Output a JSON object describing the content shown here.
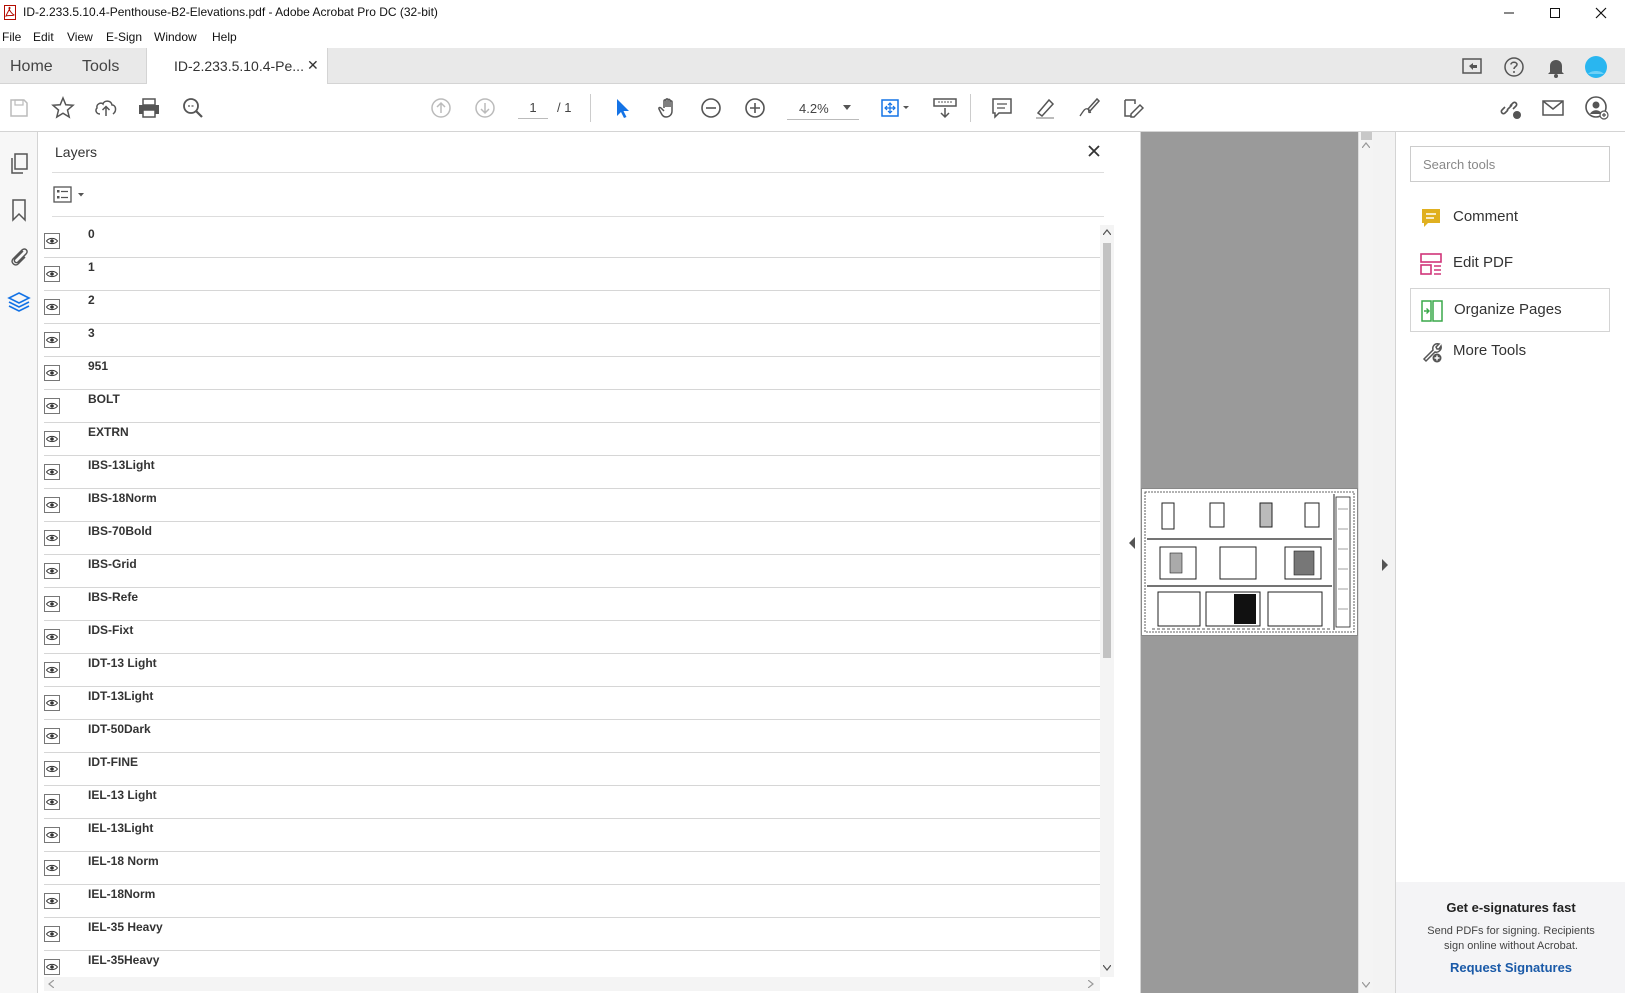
{
  "window": {
    "title": "ID-2.233.5.10.4-Penthouse-B2-Elevations.pdf - Adobe Acrobat Pro DC (32-bit)"
  },
  "menu": [
    "File",
    "Edit",
    "View",
    "E-Sign",
    "Window",
    "Help"
  ],
  "tabs": {
    "home": "Home",
    "tools": "Tools",
    "document": "ID-2.233.5.10.4-Pe...",
    "close": "✕"
  },
  "toolbar": {
    "page_current": "1",
    "page_total": "/ 1",
    "zoom": "4.2%"
  },
  "layers_panel": {
    "title": "Layers",
    "layers": [
      "0",
      "1",
      "2",
      "3",
      "951",
      "BOLT",
      "EXTRN",
      "IBS-13Light",
      "IBS-18Norm",
      "IBS-70Bold",
      "IBS-Grid",
      "IBS-Refe",
      "IDS-Fixt",
      "IDT-13 Light",
      "IDT-13Light",
      "IDT-50Dark",
      "IDT-FINE",
      "IEL-13 Light",
      "IEL-13Light",
      "IEL-18 Norm",
      "IEL-18Norm",
      "IEL-35 Heavy",
      "IEL-35Heavy"
    ]
  },
  "tools_pane": {
    "search_placeholder": "Search tools",
    "items": [
      {
        "label": "Comment",
        "icon": "comment-icon",
        "color": "#e0b020"
      },
      {
        "label": "Edit PDF",
        "icon": "edit-pdf-icon",
        "color": "#d0357a"
      },
      {
        "label": "Organize Pages",
        "icon": "organize-pages-icon",
        "color": "#3aa84a"
      },
      {
        "label": "More Tools",
        "icon": "more-tools-icon",
        "color": "#555555"
      }
    ],
    "promo": {
      "heading": "Get e-signatures fast",
      "body": "Send PDFs for signing. Recipients sign online without Acrobat.",
      "link": "Request Signatures"
    }
  },
  "colors": {
    "accent": "#1473e6",
    "avatar": "#29b6f0"
  }
}
